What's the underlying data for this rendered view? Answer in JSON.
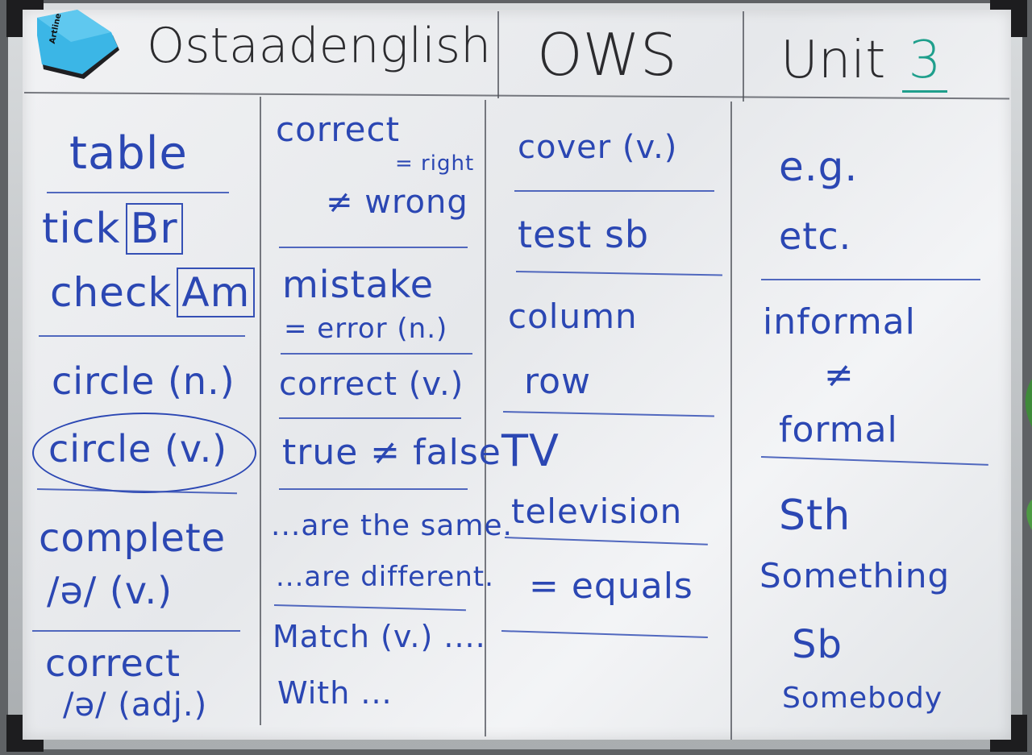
{
  "header": {
    "col1": "Ostaadenglish",
    "col2": "OWS",
    "col3_prefix": "Unit",
    "col3_number": "3",
    "eraser_brand": "Artline"
  },
  "col1": {
    "table": "table",
    "tick": "tick",
    "tick_tag": "Br",
    "check": "check",
    "check_tag": "Am",
    "circle_n": "circle (n.)",
    "circle_v": "circle (v.)",
    "complete": "complete",
    "complete_ipa": "/ə/ (v.)",
    "correct": "correct",
    "correct_ipa": "/ə/ (adj.)"
  },
  "col2": {
    "correct": "correct",
    "right": "= right",
    "neq_wrong": "≠ wrong",
    "mistake": "mistake",
    "error": "= error (n.)",
    "correct_v": "correct (v.)",
    "true_false": "true ≠ false",
    "same": "...are the same.",
    "different": "...are different.",
    "match": "Match (v.) ....",
    "with": "With ..."
  },
  "col3": {
    "cover": "cover (v.)",
    "test": "test sb",
    "column": "column",
    "row": "row",
    "tv": "TV",
    "television": "television",
    "equals": "= equals"
  },
  "col4": {
    "eg": "e.g.",
    "etc": "etc.",
    "informal": "informal",
    "neq": "≠",
    "formal": "formal",
    "sth": "Sth",
    "something": "Something",
    "sb": "Sb",
    "somebody": "Somebody"
  },
  "colors": {
    "marker_blue": "#2b47b3",
    "header_black": "#2b2b2e",
    "unit_teal": "#1f9f8c",
    "eraser_blue": "#3bb6e6"
  }
}
